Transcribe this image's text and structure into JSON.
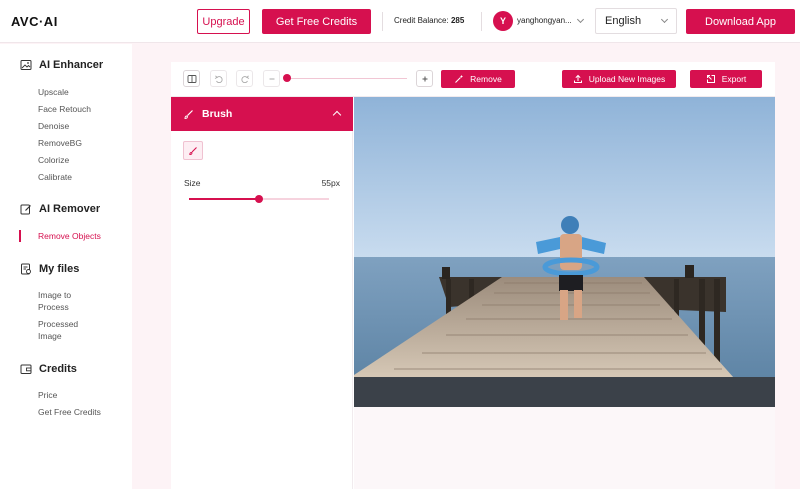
{
  "header": {
    "logo": "AVC·AI",
    "upgrade_label": "Upgrade",
    "get_credits_label": "Get Free Credits",
    "credit_balance_label": "Credit Balance:",
    "credit_balance_value": "285",
    "avatar_letter": "Y",
    "username": "yanghongyan...",
    "language": "English",
    "download_label": "Download App"
  },
  "sidebar": {
    "sections": [
      {
        "title": "AI Enhancer",
        "icon": "image-icon",
        "items": [
          "Upscale",
          "Face Retouch",
          "Denoise",
          "RemoveBG",
          "Colorize",
          "Calibrate"
        ]
      },
      {
        "title": "AI Remover",
        "icon": "edit-icon",
        "items": [
          "Remove Objects"
        ],
        "active_item": "Remove Objects"
      },
      {
        "title": "My files",
        "icon": "files-icon",
        "items": [
          "Image to Process",
          "Processed Image"
        ]
      },
      {
        "title": "Credits",
        "icon": "wallet-icon",
        "items": [
          "Price",
          "Get Free Credits"
        ]
      }
    ]
  },
  "toolbar": {
    "remove_label": "Remove",
    "upload_label": "Upload New Images",
    "export_label": "Export",
    "zoom_level": 0.0
  },
  "brush_panel": {
    "title": "Brush",
    "size_label": "Size",
    "size_value": "55px",
    "size_fraction": 0.5
  },
  "colors": {
    "accent": "#d6104f",
    "background": "#fdf3f6"
  }
}
